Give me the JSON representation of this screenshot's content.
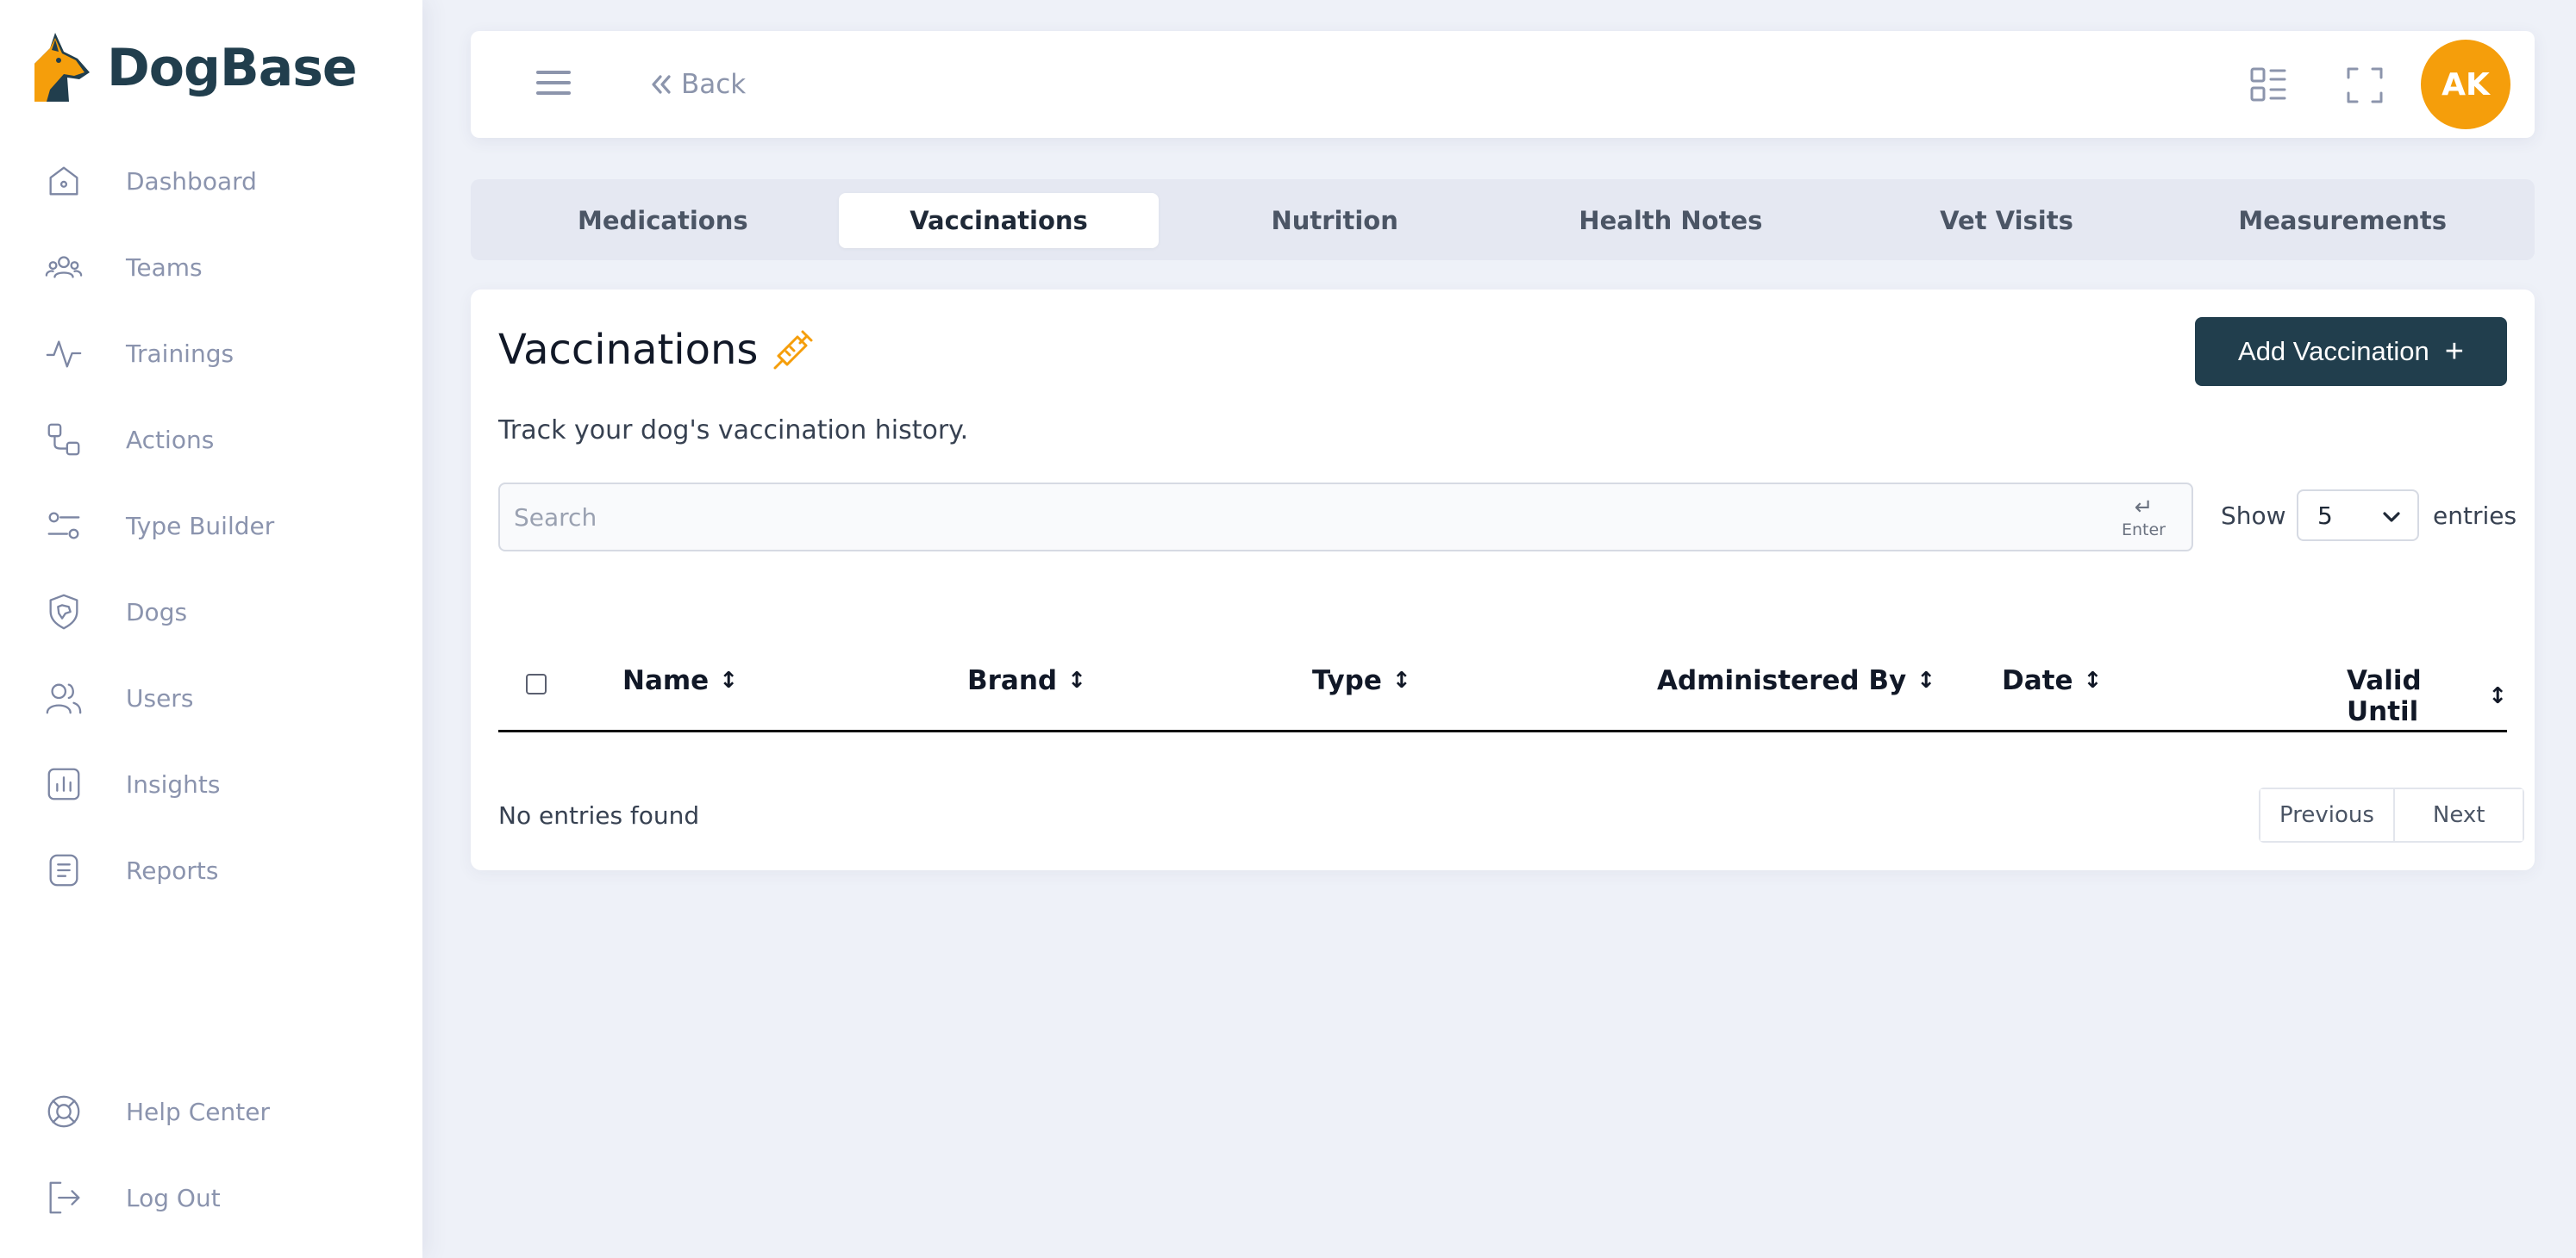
{
  "app": {
    "name": "DogBase",
    "accent": "#f59e0b",
    "brand": "#213e4d"
  },
  "sidebar": {
    "items": [
      {
        "label": "Dashboard",
        "icon": "home-icon"
      },
      {
        "label": "Teams",
        "icon": "team-icon"
      },
      {
        "label": "Trainings",
        "icon": "activity-icon"
      },
      {
        "label": "Actions",
        "icon": "actions-icon"
      },
      {
        "label": "Type Builder",
        "icon": "sliders-icon"
      },
      {
        "label": "Dogs",
        "icon": "dog-shield-icon"
      },
      {
        "label": "Users",
        "icon": "users-icon"
      },
      {
        "label": "Insights",
        "icon": "chart-icon"
      },
      {
        "label": "Reports",
        "icon": "report-icon"
      }
    ],
    "bottom": [
      {
        "label": "Help Center",
        "icon": "lifebuoy-icon"
      },
      {
        "label": "Log Out",
        "icon": "logout-icon"
      }
    ]
  },
  "topbar": {
    "back_label": "Back",
    "avatar_initials": "AK"
  },
  "tabs": [
    {
      "label": "Medications",
      "active": false
    },
    {
      "label": "Vaccinations",
      "active": true
    },
    {
      "label": "Nutrition",
      "active": false
    },
    {
      "label": "Health Notes",
      "active": false
    },
    {
      "label": "Vet Visits",
      "active": false
    },
    {
      "label": "Measurements",
      "active": false
    }
  ],
  "card": {
    "title": "Vaccinations",
    "title_icon": "syringe-icon",
    "subtitle": "Track your dog's vaccination history.",
    "add_label": "Add Vaccination",
    "add_icon": "+",
    "search": {
      "placeholder": "Search",
      "value": "",
      "enter_hint": "Enter",
      "enter_glyph": "↵"
    },
    "show_label": "Show",
    "page_size": "5",
    "entries_label": "entries",
    "columns": [
      "Name",
      "Brand",
      "Type",
      "Administered By",
      "Date",
      "Valid Until"
    ],
    "sort_glyph": "↕",
    "empty_text": "No entries found",
    "pager": {
      "previous": "Previous",
      "next": "Next"
    }
  }
}
